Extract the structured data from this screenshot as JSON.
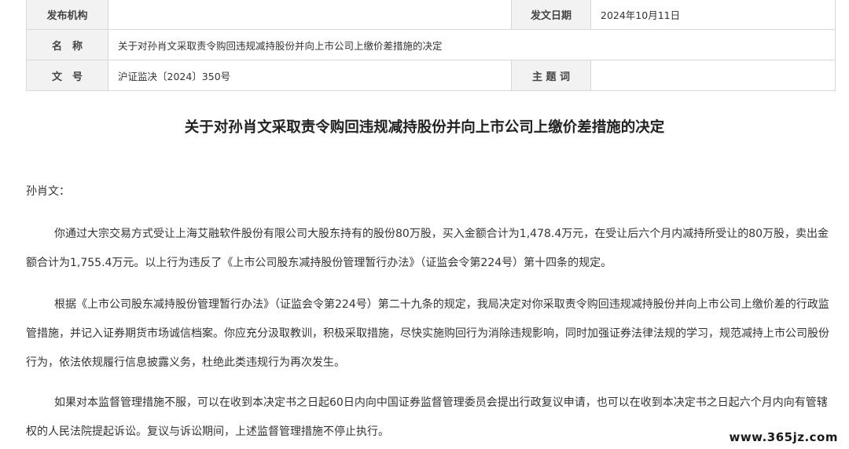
{
  "meta_table": {
    "publisher_label": "发布机构",
    "publisher_value": "",
    "date_label": "发文日期",
    "date_value": "2024年10月11日",
    "name_label": "名　称",
    "name_value": "关于对孙肖文采取责令购回违规减持股份并向上市公司上缴价差措施的决定",
    "doc_no_label": "文　号",
    "doc_no_value": "沪证监决〔2024〕350号",
    "subject_label": "主 题 词",
    "subject_value": ""
  },
  "document": {
    "title": "关于对孙肖文采取责令购回违规减持股份并向上市公司上缴价差措施的决定",
    "salutation": "孙肖文：",
    "paragraphs": [
      "你通过大宗交易方式受让上海艾融软件股份有限公司大股东持有的股份80万股，买入金额合计为1,478.4万元，在受让后六个月内减持所受让的80万股，卖出金额合计为1,755.4万元。以上行为违反了《上市公司股东减持股份管理暂行办法》（证监会令第224号）第十四条的规定。",
      "根据《上市公司股东减持股份管理暂行办法》（证监会令第224号）第二十九条的规定，我局决定对你采取责令购回违规减持股份并向上市公司上缴价差的行政监管措施，并记入证券期货市场诚信档案。你应充分汲取教训，积极采取措施，尽快实施购回行为消除违规影响，同时加强证券法律法规的学习，规范减持上市公司股份行为，依法依规履行信息披露义务，杜绝此类违规行为再次发生。",
      "如果对本监督管理措施不服，可以在收到本决定书之日起60日内向中国证券监督管理委员会提出行政复议申请，也可以在收到本决定书之日起六个月内向有管辖权的人民法院提起诉讼。复议与诉讼期间，上述监督管理措施不停止执行。"
    ]
  },
  "watermark": "www.365jz.com"
}
